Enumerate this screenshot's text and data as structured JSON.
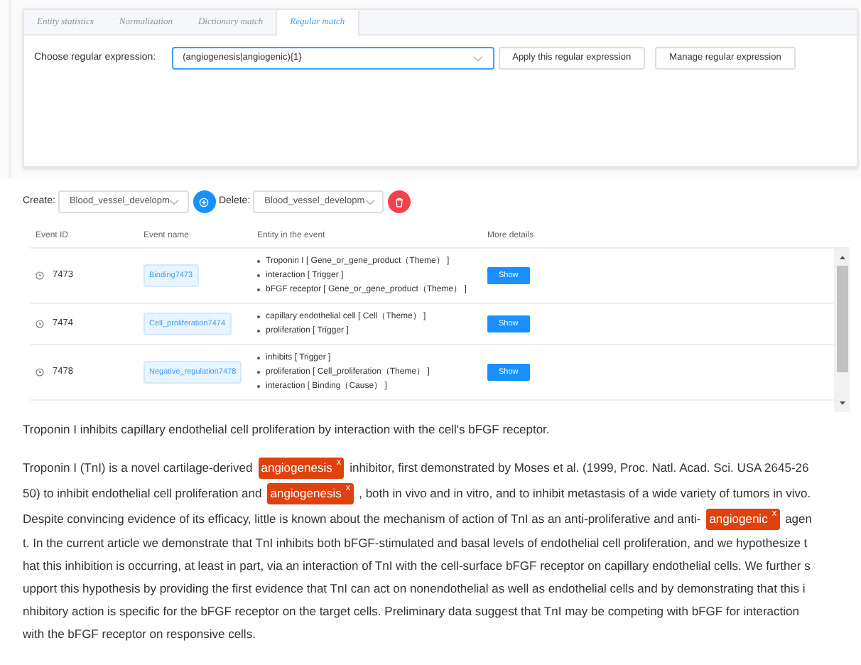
{
  "tabs": [
    {
      "label": "Entity statistics",
      "selected": false
    },
    {
      "label": "Normalization",
      "selected": false
    },
    {
      "label": "Dictionary match",
      "selected": false
    },
    {
      "label": "Regular match",
      "selected": true
    }
  ],
  "regex_picker": {
    "label": "Choose regular expression:",
    "value": "(angiogenesis|angiogenic){1}",
    "buttons": [
      "Apply this regular expression",
      "Manage regular expression"
    ]
  },
  "toolbar": {
    "create_label": "Create:",
    "create_value": "Blood_vessel_developm",
    "delete_label": "Delete:",
    "delete_value": "Blood_vessel_developm"
  },
  "table": {
    "columns": [
      "Event ID",
      "Event name",
      "Entity in the event",
      "More details"
    ],
    "rows": [
      {
        "id": "7473",
        "name": "Binding7473",
        "entities": [
          "Troponin I [ Gene_or_gene_product（Theme） ]",
          "interaction [ Trigger ]",
          "bFGF receptor [ Gene_or_gene_product（Theme） ]"
        ],
        "action": "Show"
      },
      {
        "id": "7474",
        "name": "Cell_proliferation7474",
        "entities": [
          "capillary endothelial cell [ Cell（Theme） ]",
          "proliferation [ Trigger ]"
        ],
        "action": "Show"
      },
      {
        "id": "7478",
        "name": "Negative_regulation7478",
        "entities": [
          "inhibits [ Trigger ]",
          "proliferation [ Cell_proliferation（Theme） ]",
          "interaction [ Binding（Cause） ]"
        ],
        "action": "Show"
      }
    ]
  },
  "title": "Troponin I inhibits capillary endothelial cell proliferation by interaction with the cell's bFGF receptor.",
  "abstract_lines": [
    [
      {
        "kind": "text",
        "text": "Troponin I (TnI) is a novel cartilage-derived"
      },
      {
        "kind": "tag",
        "text": "angiogenesis",
        "close": "x"
      },
      {
        "kind": "text",
        "text": "inhibitor, first demonstrated by Moses et al. (1999, Proc. Natl. Acad. Sci. USA 2645-26"
      }
    ],
    [
      {
        "kind": "text",
        "text": "50) to inhibit endothelial cell proliferation and"
      },
      {
        "kind": "tag",
        "text": "angiogenesis",
        "close": "x"
      },
      {
        "kind": "text",
        "text": ", both in vivo and in vitro, and to inhibit metastasis of a wide variety of tumors in vivo."
      }
    ],
    [
      {
        "kind": "text",
        "text": "Despite convincing evidence of its efficacy, little is known about the mechanism of action of TnI as an anti-proliferative and anti-"
      },
      {
        "kind": "tag",
        "text": "angiogenic",
        "close": "x"
      },
      {
        "kind": "text",
        "text": "agen"
      }
    ],
    [
      {
        "kind": "text",
        "text": "t. In the current article we demonstrate that TnI inhibits both bFGF-stimulated and basal levels of endothelial cell proliferation, and we hypothesize t"
      }
    ],
    [
      {
        "kind": "text",
        "text": "hat this inhibition is occurring, at least in part, via an interaction of TnI with the cell-surface bFGF receptor on capillary endothelial cells. We further s"
      }
    ],
    [
      {
        "kind": "text",
        "text": "upport this hypothesis by providing the first evidence that TnI can act on nonendothelial as well as endothelial cells and by demonstrating that this i"
      }
    ],
    [
      {
        "kind": "text",
        "text": "nhibitory action is specific for the bFGF receptor on the target cells. Preliminary data suggest that TnI may be competing with bFGF for interaction"
      }
    ],
    [
      {
        "kind": "text",
        "text": "with the bFGF receptor on responsive cells."
      }
    ]
  ]
}
